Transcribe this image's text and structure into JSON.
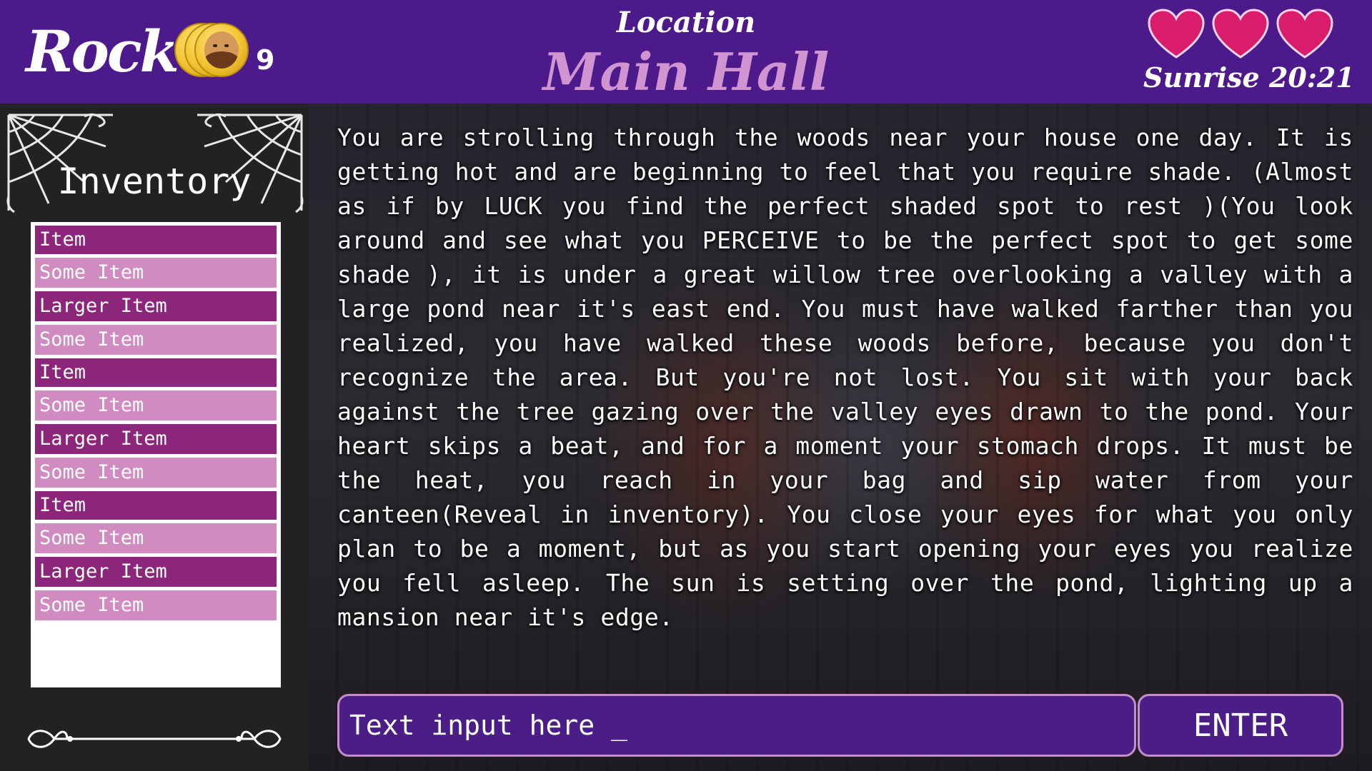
{
  "header": {
    "player_name": "Rocko",
    "coin_icon": "coin-stack-icon",
    "coin_count": "9",
    "location_label": "Location",
    "location_name": "Main Hall",
    "lives": {
      "count": 3,
      "icon": "heart-icon",
      "color": "#d91c6b"
    },
    "time": "Sunrise 20:21"
  },
  "sidebar": {
    "title": "Inventory",
    "items": [
      {
        "label": "Item",
        "style": "dark"
      },
      {
        "label": "Some Item",
        "style": "light"
      },
      {
        "label": "Larger Item",
        "style": "dark"
      },
      {
        "label": "Some Item",
        "style": "light"
      },
      {
        "label": "Item",
        "style": "dark"
      },
      {
        "label": "Some Item",
        "style": "light"
      },
      {
        "label": "Larger Item",
        "style": "dark"
      },
      {
        "label": "Some Item",
        "style": "light"
      },
      {
        "label": "Item",
        "style": "dark"
      },
      {
        "label": "Some Item",
        "style": "light"
      },
      {
        "label": "Larger Item",
        "style": "dark"
      },
      {
        "label": "Some Item",
        "style": "light"
      }
    ]
  },
  "main": {
    "story_text": "You are strolling through the woods near your house one day. It is getting hot and are beginning to feel that you require shade. (Almost as if by LUCK you find the perfect shaded spot to rest )(You look around and see what you PERCEIVE to be the perfect spot to get some shade ), it is under a great willow tree overlooking a valley with a large pond near it's east end. You must have walked farther than you realized, you have walked these woods before, because you don't recognize the area. But you're not lost. You sit with your back against the tree gazing over the valley eyes drawn to the pond. Your heart skips a beat, and for a moment your stomach drops. It must be the heat, you reach in your bag and sip water from your canteen(Reveal in inventory). You close your eyes for what you only plan to be a moment, but as you start opening your eyes you realize you fell asleep. The sun is setting over the pond, lighting up a mansion near it's edge.",
    "input_placeholder": "Text input here _",
    "enter_label": "ENTER"
  },
  "colors": {
    "header_bg": "#4d1a8c",
    "location_name": "#d094d0",
    "item_dark": "#8c267a",
    "item_light": "#d08cc0",
    "input_bg": "#4a1e86",
    "input_border": "#c58ec8"
  }
}
